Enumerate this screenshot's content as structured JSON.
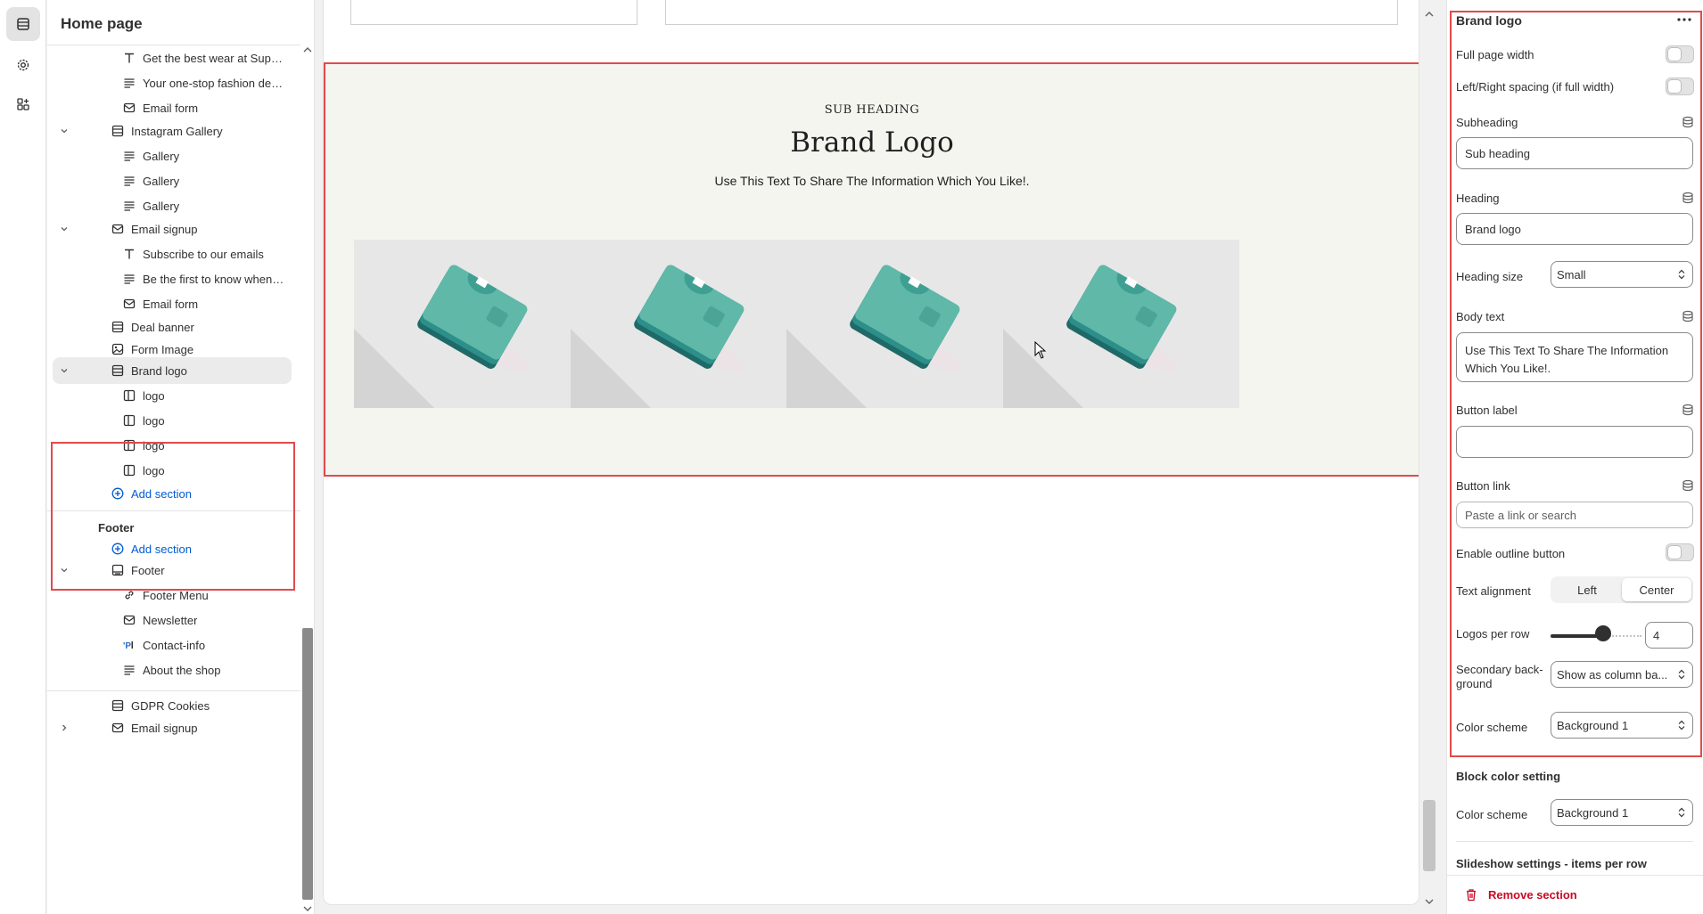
{
  "left_panel": {
    "title": "Home page",
    "items": [
      {
        "label": "Get the best wear at Support, th...",
        "icon": "text-icon"
      },
      {
        "label": "Your one-stop fashion destinati...",
        "icon": "paragraph-icon"
      },
      {
        "label": "Email form",
        "icon": "email-icon"
      },
      {
        "label": "Instagram Gallery",
        "icon": "section-icon"
      },
      {
        "label": "Gallery",
        "icon": "paragraph-icon"
      },
      {
        "label": "Gallery",
        "icon": "paragraph-icon"
      },
      {
        "label": "Gallery",
        "icon": "paragraph-icon"
      },
      {
        "label": "Email signup",
        "icon": "email-icon"
      },
      {
        "label": "Subscribe to our emails",
        "icon": "text-icon"
      },
      {
        "label": "Be the first to know when we la...",
        "icon": "paragraph-icon"
      },
      {
        "label": "Email form",
        "icon": "email-icon"
      },
      {
        "label": "Deal banner",
        "icon": "section-icon"
      },
      {
        "label": "Form Image",
        "icon": "image-icon"
      },
      {
        "label": "Brand logo",
        "icon": "section-icon"
      },
      {
        "label": "logo",
        "icon": "column-icon"
      },
      {
        "label": "logo",
        "icon": "column-icon"
      },
      {
        "label": "logo",
        "icon": "column-icon"
      },
      {
        "label": "logo",
        "icon": "column-icon"
      }
    ],
    "add_section": "Add section",
    "footer_heading": "Footer",
    "footer_add_section": "Add section",
    "footer_items": [
      {
        "label": "Footer",
        "icon": "footer-icon"
      },
      {
        "label": "Footer Menu",
        "icon": "link-icon"
      },
      {
        "label": "Newsletter",
        "icon": "email-icon"
      },
      {
        "label": "Contact-info",
        "icon": "contact-icon"
      },
      {
        "label": "About the shop",
        "icon": "paragraph-icon"
      }
    ],
    "bottom_items": [
      {
        "label": "GDPR Cookies",
        "icon": "section-icon"
      },
      {
        "label": "Email signup",
        "icon": "email-icon"
      }
    ]
  },
  "preview": {
    "sub_heading": "SUB HEADING",
    "heading": "Brand Logo",
    "body": "Use This Text To Share The Information Which You Like!.",
    "logo_count": 4,
    "accent": "#5fb8a8"
  },
  "settings": {
    "title": "Brand logo",
    "more_icon": "more-icon",
    "full_page_width": "Full page width",
    "lr_spacing": "Left/Right spacing (if full width)",
    "subheading_label": "Subheading",
    "subheading_value": "Sub heading",
    "heading_label": "Heading",
    "heading_value": "Brand logo",
    "heading_size_label": "Heading size",
    "heading_size_value": "Small",
    "body_label": "Body text",
    "body_value": "Use This Text To Share The Information Which You Like!.",
    "button_label_label": "Button label",
    "button_label_value": "",
    "button_link_label": "Button link",
    "button_link_placeholder": "Paste a link or search",
    "outline_label": "Enable outline button",
    "text_align_label": "Text alignment",
    "align_left": "Left",
    "align_center": "Center",
    "logos_per_row_label": "Logos per row",
    "logos_per_row_value": "4",
    "secondary_bg_label_1": "Secondary back-",
    "secondary_bg_label_2": "ground",
    "secondary_bg_value": "Show as column ba...",
    "color_scheme_label": "Color scheme",
    "color_scheme_value": "Background 1",
    "block_color_title": "Block color setting",
    "block_color_scheme_label": "Color scheme",
    "block_color_scheme_value": "Background 1",
    "slideshow_title": "Slideshow settings - items per row",
    "remove_section": "Remove section"
  },
  "colors": {
    "highlight": "#e04b4b",
    "link": "#005bd3",
    "danger": "#c70a24"
  }
}
